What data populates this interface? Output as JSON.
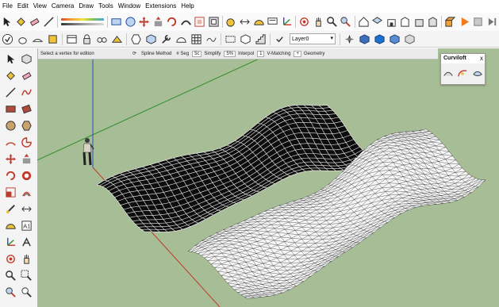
{
  "menu": {
    "items": [
      "File",
      "Edit",
      "View",
      "Camera",
      "Draw",
      "Tools",
      "Window",
      "Extensions",
      "Help"
    ]
  },
  "layer": {
    "name": "Layer0"
  },
  "status": {
    "prompt": "Select a vertex for edition",
    "labels": [
      "Spline Method",
      "# Seg",
      "Simplify",
      "Interpol",
      "V-Matching",
      "Geometry"
    ],
    "values": [
      "5c",
      "5%",
      "1",
      "+"
    ]
  },
  "plugin": {
    "title": "Curviloft",
    "close": "x"
  },
  "colors": {
    "viewport": "#a7bd96",
    "axis_red": "#c0392b",
    "axis_green": "#2f8f2f",
    "axis_blue": "#2b4fbf",
    "accent": "#1a6fd1"
  },
  "icons": {
    "toolbar": [
      "select-icon",
      "paint-bucket-icon",
      "eraser-icon",
      "line-icon",
      "rectangle-icon",
      "circle-icon",
      "move-icon",
      "push-pull-icon",
      "rotate-icon",
      "follow-me-icon",
      "scale-icon",
      "offset-icon",
      "tape-icon",
      "dimension-icon",
      "protractor-icon",
      "text-icon",
      "axes-icon",
      "3d-text-icon",
      "orbit-icon",
      "pan-icon",
      "zoom-icon",
      "zoom-extents-icon",
      "warehouse-icon",
      "extension-icon"
    ],
    "left": [
      "select-icon",
      "make-component-icon",
      "paint-bucket-icon",
      "eraser-icon",
      "line-icon",
      "freehand-icon",
      "rectangle-icon",
      "rotated-rectangle-icon",
      "circle-icon",
      "polygon-icon",
      "arc-icon",
      "pie-icon",
      "move-icon",
      "push-pull-icon",
      "rotate-icon",
      "follow-me-icon",
      "scale-icon",
      "offset-icon",
      "tape-icon",
      "dimension-icon",
      "protractor-icon",
      "text-icon",
      "axes-icon",
      "3d-text-icon",
      "orbit-icon",
      "pan-icon",
      "zoom-icon",
      "zoom-window-icon"
    ],
    "plugin": [
      "loft-by-spline-icon",
      "loft-along-path-icon",
      "skinning-icon"
    ]
  }
}
